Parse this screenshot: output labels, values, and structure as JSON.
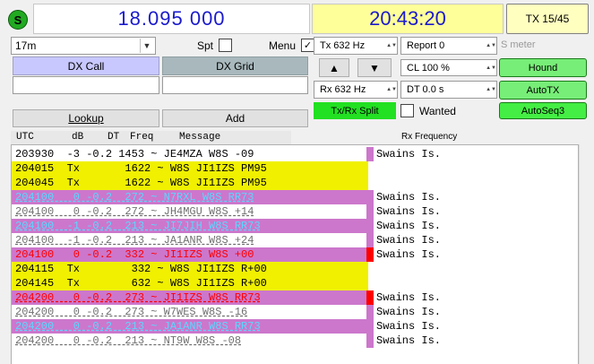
{
  "top": {
    "status_letter": "S",
    "frequency": "18.095 000",
    "time": "20:43:20",
    "tx_period": "TX 15/45"
  },
  "band": {
    "value": "17m"
  },
  "spot": {
    "label": "Spt",
    "checked": false
  },
  "menu": {
    "label": "Menu",
    "checked": true,
    "check_glyph": "✓"
  },
  "tx_freq": {
    "label": "Tx  632  Hz"
  },
  "rx_freq": {
    "label": "Rx  632  Hz"
  },
  "report": {
    "label": "Report 0"
  },
  "smeter_label": "S meter",
  "cl": {
    "label": "CL  100 %"
  },
  "dt": {
    "label": "DT 0.0 s"
  },
  "buttons": {
    "up": "▲",
    "down": "▼",
    "hound": "Hound",
    "autotx": "AutoTX",
    "autoseq": "AutoSeq3",
    "txrx_split": "Tx/Rx Split",
    "lookup": "Lookup",
    "add": "Add"
  },
  "wanted": {
    "label": "Wanted",
    "checked": false
  },
  "dx": {
    "call_label": "DX Call",
    "grid_label": "DX Grid",
    "call_value": "",
    "grid_value": ""
  },
  "list": {
    "headers": {
      "utc": "UTC",
      "db": "dB",
      "dt": "DT",
      "freq": "Freq",
      "message": "Message",
      "rx_frequency": "Rx Frequency"
    },
    "rows": [
      {
        "text": "203930  -3 -0.2 1453 ~ JE4MZA W8S -09",
        "loc": "Swains Is.",
        "bg": "#ffffff",
        "fg": "#000000",
        "marker": "#cc77cc",
        "underline": false,
        "locbg": "#ffffff"
      },
      {
        "text": "204015  Tx       1622 ~ W8S JI1IZS PM95",
        "loc": "",
        "bg": "#f0f000",
        "fg": "#000000",
        "marker": "",
        "underline": false,
        "locbg": "#ffffff"
      },
      {
        "text": "204045  Tx       1622 ~ W8S JI1IZS PM95",
        "loc": "",
        "bg": "#f0f000",
        "fg": "#000000",
        "marker": "",
        "underline": false,
        "locbg": "#ffffff"
      },
      {
        "text": "204100   0 -0.2  272 ~ N7RXL W8S RR73",
        "loc": "Swains Is.",
        "bg": "#cc77cc",
        "fg": "#5ad8ff",
        "marker": "#cc77cc",
        "underline": true,
        "locbg": "#ffffff"
      },
      {
        "text": "204100   0 -0.2  272 ~ JH4MGU W8S +14",
        "loc": "Swains Is.",
        "bg": "#ffffff",
        "fg": "#707070",
        "marker": "#cc77cc",
        "underline": true,
        "locbg": "#ffffff"
      },
      {
        "text": "204100  -1 -0.2  213 ~ JI7JIH W8S RR73",
        "loc": "Swains Is.",
        "bg": "#cc77cc",
        "fg": "#5ad8ff",
        "marker": "#cc77cc",
        "underline": true,
        "locbg": "#ffffff"
      },
      {
        "text": "204100  -1 -0.2  213 ~ JA1ANR W8S +24",
        "loc": "Swains Is.",
        "bg": "#ffffff",
        "fg": "#707070",
        "marker": "#cc77cc",
        "underline": true,
        "locbg": "#ffffff"
      },
      {
        "text": "204100   0 -0.2  332 ~ JI1IZS W8S +00",
        "loc": "Swains Is.",
        "bg": "#cc77cc",
        "fg": "#ff0000",
        "marker": "#ff0000",
        "underline": false,
        "locbg": "#ffffff"
      },
      {
        "text": "204115  Tx        332 ~ W8S JI1IZS R+00",
        "loc": "",
        "bg": "#f0f000",
        "fg": "#000000",
        "marker": "",
        "underline": false,
        "locbg": "#ffffff"
      },
      {
        "text": "204145  Tx        632 ~ W8S JI1IZS R+00",
        "loc": "",
        "bg": "#f0f000",
        "fg": "#000000",
        "marker": "",
        "underline": false,
        "locbg": "#ffffff"
      },
      {
        "text": "204200   0 -0.2  273 ~ JI1IZS W8S RR73",
        "loc": "Swains Is.",
        "bg": "#cc77cc",
        "fg": "#ff0000",
        "marker": "#ff0000",
        "underline": true,
        "locbg": "#ffffff"
      },
      {
        "text": "204200   0 -0.2  273 ~ W7WES W8S -16",
        "loc": "Swains Is.",
        "bg": "#ffffff",
        "fg": "#707070",
        "marker": "#cc77cc",
        "underline": true,
        "locbg": "#ffffff"
      },
      {
        "text": "204200   0 -0.2  213 ~ JA1ANR W8S RR73",
        "loc": "Swains Is.",
        "bg": "#cc77cc",
        "fg": "#5ad8ff",
        "marker": "#cc77cc",
        "underline": true,
        "locbg": "#ffffff"
      },
      {
        "text": "204200   0 -0.2  213 ~ NT9W W8S -08",
        "loc": "Swains Is.",
        "bg": "#ffffff",
        "fg": "#707070",
        "marker": "#cc77cc",
        "underline": true,
        "locbg": "#ffffff"
      }
    ]
  }
}
